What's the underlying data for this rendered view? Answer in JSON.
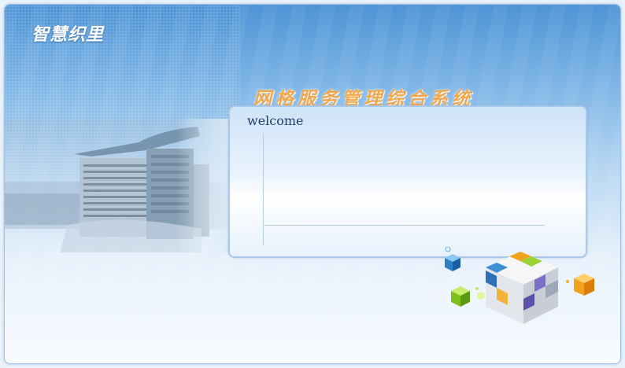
{
  "app": {
    "logo_text": "智慧织里",
    "title": "网格服务管理综合系统"
  },
  "panel": {
    "welcome_text": "welcome"
  },
  "colors": {
    "title_accent": "#f2a84a",
    "welcome_text": "#1f3f6c",
    "background_blue": "#4e94d6"
  },
  "images": {
    "building": "building-photo",
    "decoration": "cube-illustration"
  }
}
